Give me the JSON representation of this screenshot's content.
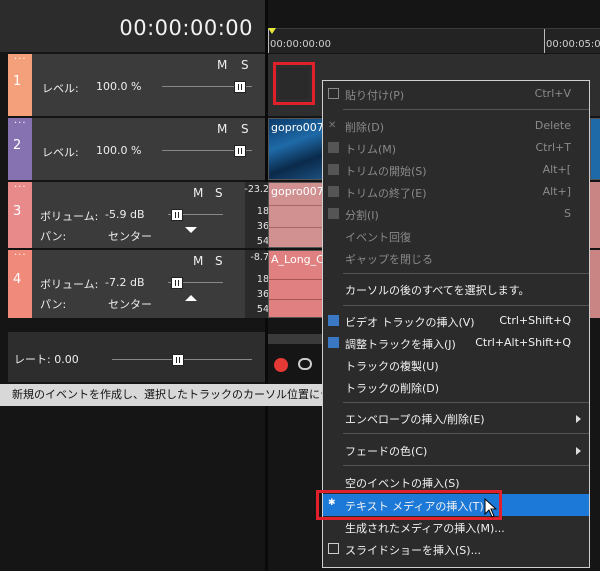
{
  "header": {
    "timecode": "00:00:00:00"
  },
  "ruler": {
    "start_time": "00:00:00:00",
    "end_time": "00:00:05:0"
  },
  "tracks": [
    {
      "number": "1",
      "color": "#f4a07a",
      "mute": "M",
      "solo": "S",
      "param_label": "レベル:",
      "param_value": "100.0 %"
    },
    {
      "number": "2",
      "color": "#8672b0",
      "mute": "M",
      "solo": "S",
      "param_label": "レベル:",
      "param_value": "100.0 %"
    },
    {
      "number": "3",
      "color": "#e88a8a",
      "mute": "M",
      "solo": "S",
      "vol_label": "ボリューム:",
      "vol_value": "-5.9 dB",
      "pan_label": "パン:",
      "pan_value": "センター",
      "meter": [
        "-23.2",
        "18",
        "36",
        "54"
      ]
    },
    {
      "number": "4",
      "color": "#f08a7a",
      "mute": "M",
      "solo": "S",
      "vol_label": "ボリューム:",
      "vol_value": "-7.2 dB",
      "pan_label": "パン:",
      "pan_value": "センター",
      "meter": [
        "-8.7",
        "18",
        "36",
        "54"
      ]
    }
  ],
  "clips": {
    "video_top": "gopro007",
    "video_bottom": "gopro007",
    "audio": "A_Long_C"
  },
  "bottom": {
    "rate_label": "レート:  0.00"
  },
  "status": "新規のイベントを作成し、選択したトラックのカーソル位置にテキスト",
  "menu": {
    "items": [
      {
        "label": "貼り付け(P)",
        "shortcut": "Ctrl+V",
        "enabled": false
      },
      {
        "label": "削除(D)",
        "shortcut": "Delete",
        "enabled": false
      },
      {
        "label": "トリム(M)",
        "shortcut": "Ctrl+T",
        "enabled": false
      },
      {
        "label": "トリムの開始(S)",
        "shortcut": "Alt+[",
        "enabled": false
      },
      {
        "label": "トリムの終了(E)",
        "shortcut": "Alt+]",
        "enabled": false
      },
      {
        "label": "分割(I)",
        "shortcut": "S",
        "enabled": false
      },
      {
        "label": "イベント回復",
        "shortcut": "",
        "enabled": false
      },
      {
        "label": "ギャップを閉じる",
        "shortcut": "",
        "enabled": false
      },
      {
        "label": "カーソルの後のすべてを選択します。",
        "shortcut": "",
        "enabled": true
      },
      {
        "label": "ビデオ トラックの挿入(V)",
        "shortcut": "Ctrl+Shift+Q",
        "enabled": true
      },
      {
        "label": "調整トラックを挿入(J)",
        "shortcut": "Ctrl+Alt+Shift+Q",
        "enabled": true
      },
      {
        "label": "トラックの複製(U)",
        "shortcut": "",
        "enabled": true
      },
      {
        "label": "トラックの削除(D)",
        "shortcut": "",
        "enabled": true
      },
      {
        "label": "エンベロープの挿入/削除(E)",
        "shortcut": "",
        "enabled": true
      },
      {
        "label": "フェードの色(C)",
        "shortcut": "",
        "enabled": true
      },
      {
        "label": "空のイベントの挿入(S)",
        "shortcut": "",
        "enabled": true
      },
      {
        "label": "テキスト メディアの挿入(T)...",
        "shortcut": "",
        "enabled": true
      },
      {
        "label": "生成されたメディアの挿入(M)...",
        "shortcut": "",
        "enabled": true
      },
      {
        "label": "スライドショーを挿入(S)...",
        "shortcut": "",
        "enabled": true
      }
    ]
  },
  "colors": {
    "accent": "#1c79d8",
    "highlight_box": "#e0202b",
    "record": "#e53935"
  }
}
